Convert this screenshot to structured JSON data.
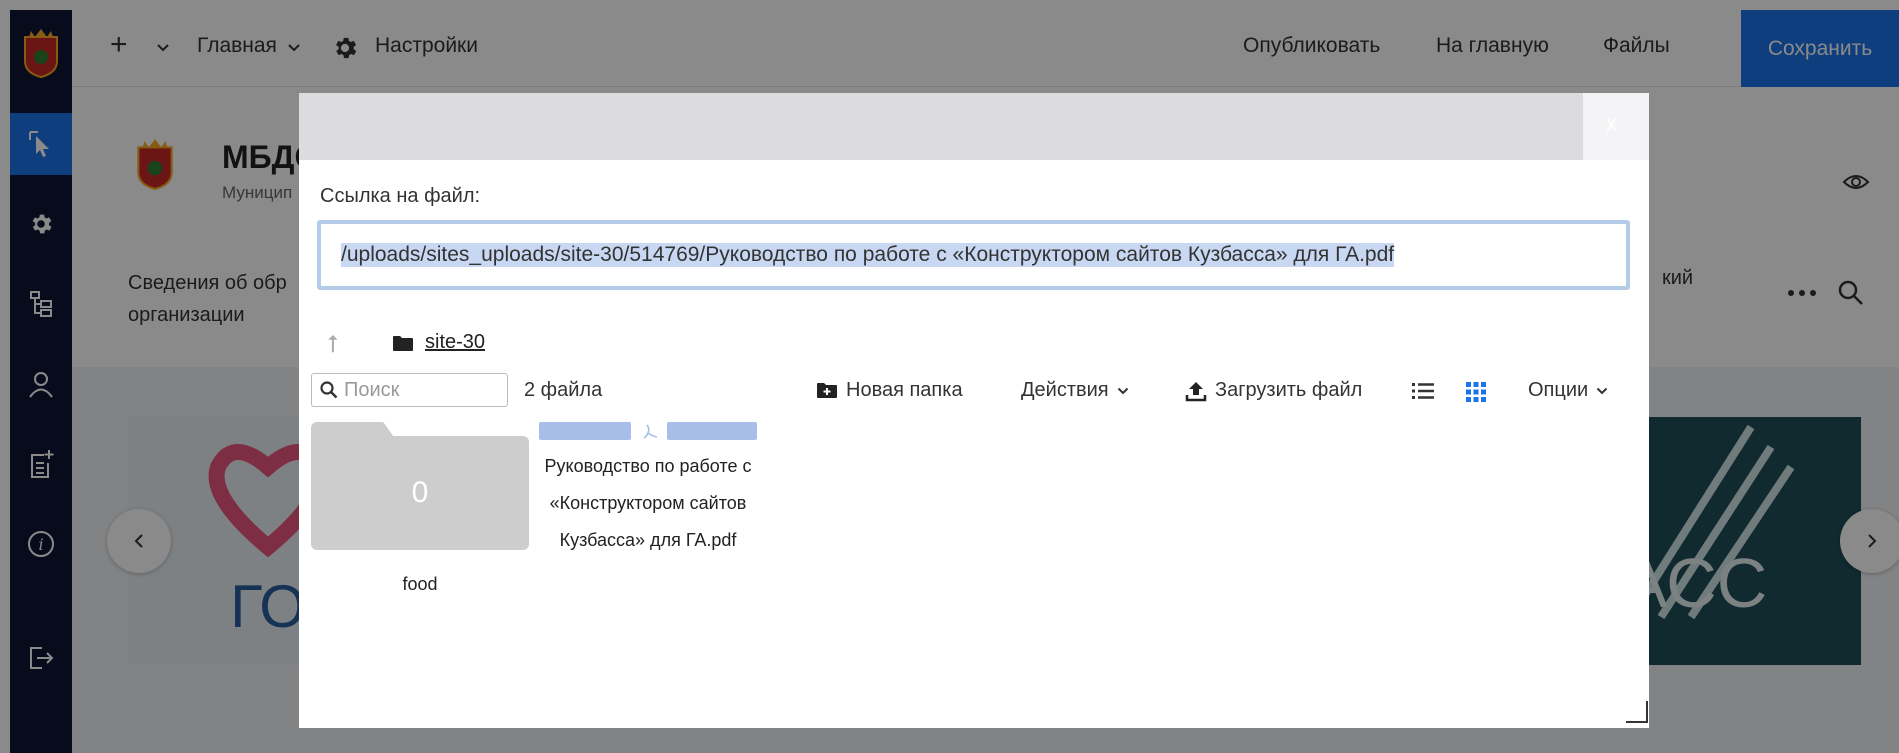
{
  "topbar": {
    "add_label": "+",
    "home_menu": "Главная",
    "settings": "Настройки",
    "publish": "Опубликовать",
    "to_main": "На главную",
    "files": "Файлы",
    "save": "Сохранить"
  },
  "page_header": {
    "title": "МБДО",
    "subtitle": "Муницип",
    "nav_line1": "Сведения об обр",
    "nav_line2": "организации",
    "nav_right": "кий"
  },
  "modal": {
    "close_label": "x",
    "link_label": "Ссылка на файл:",
    "link_value": "/uploads/sites_uploads/site-30/514769/Руководство по работе с «Конструктором сайтов Кузбасса» для ГА.pdf",
    "breadcrumb": "site-30",
    "search_placeholder": "Поиск",
    "file_count": "2 файла",
    "new_folder": "Новая папка",
    "actions": "Действия",
    "upload": "Загрузить файл",
    "options": "Опции",
    "items": [
      {
        "type": "folder",
        "count": "0",
        "name": "food"
      },
      {
        "type": "pdf",
        "name": "Руководство по работе с «Конструктором сайтов Кузбасса» для ГА.pdf"
      }
    ]
  },
  "colors": {
    "sidebar": "#0e1633",
    "accent": "#1a73e8",
    "modal_titlebar": "#dcdcdf",
    "selection": "#c8d8f2"
  }
}
